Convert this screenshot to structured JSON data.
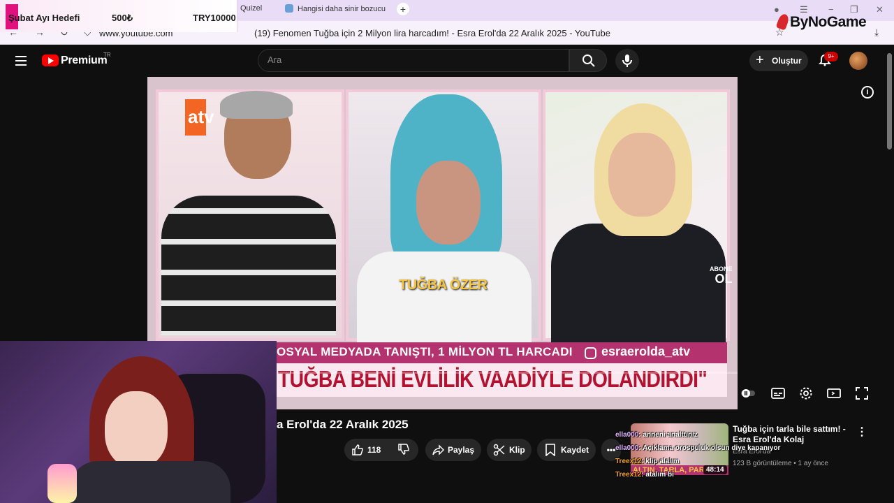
{
  "browser": {
    "tabs": [
      {
        "label": "Quizel"
      },
      {
        "label": "Hangisi daha sinir bozucu"
      }
    ],
    "url": "www.youtube.com",
    "page_title": "(19) Fenomen Tuğba için 2 Milyon lira harcadım! - Esra Erol'da 22 Aralık 2025 - YouTube"
  },
  "donation": {
    "label": "Şubat Ayı Hedefi",
    "current": "500₺",
    "goal": "TRY10000"
  },
  "sponsor_logo": "ByNoGame",
  "youtube": {
    "logo_text": "Premium",
    "country": "TR",
    "search_placeholder": "Ara",
    "create_label": "Oluştur",
    "notifications": "9+"
  },
  "video": {
    "channel_bug": "atv",
    "name_tag": "TUĞBA ÖZER",
    "headline_top": "OSYAL MEDYADA TANIŞTI, 1 MİLYON TL HARCADI",
    "instagram": "esraerolda_atv",
    "headline_main": "TUĞBA BENİ EVLİLİK VAADİYLE DOLANDIRDI\"",
    "subscribe_top": "ABONE",
    "subscribe_bottom": "OL",
    "title": "a Erol'da 22 Aralık 2025"
  },
  "actions": {
    "like_count": "118",
    "share": "Paylaş",
    "clip": "Klip",
    "save": "Kaydet"
  },
  "recommendation": {
    "title": "Tuğba için tarla bile sattım! - Esra Erol'da Kolaj",
    "channel": "Esra Erol'da",
    "meta": "123 B görüntüleme • 1 ay önce",
    "duration": "48:14",
    "thumb_text": "ALTIN, TARLA, PARA"
  },
  "chat": [
    {
      "user": "ella000",
      "message": "anneni analttınız"
    },
    {
      "user": "ella000",
      "message": "Açıklama orospuluk olsun diye kapanıyor"
    },
    {
      "user": "Treex12",
      "message": "klip alalım"
    },
    {
      "user": "Treex12",
      "message": "atalım bi"
    }
  ]
}
